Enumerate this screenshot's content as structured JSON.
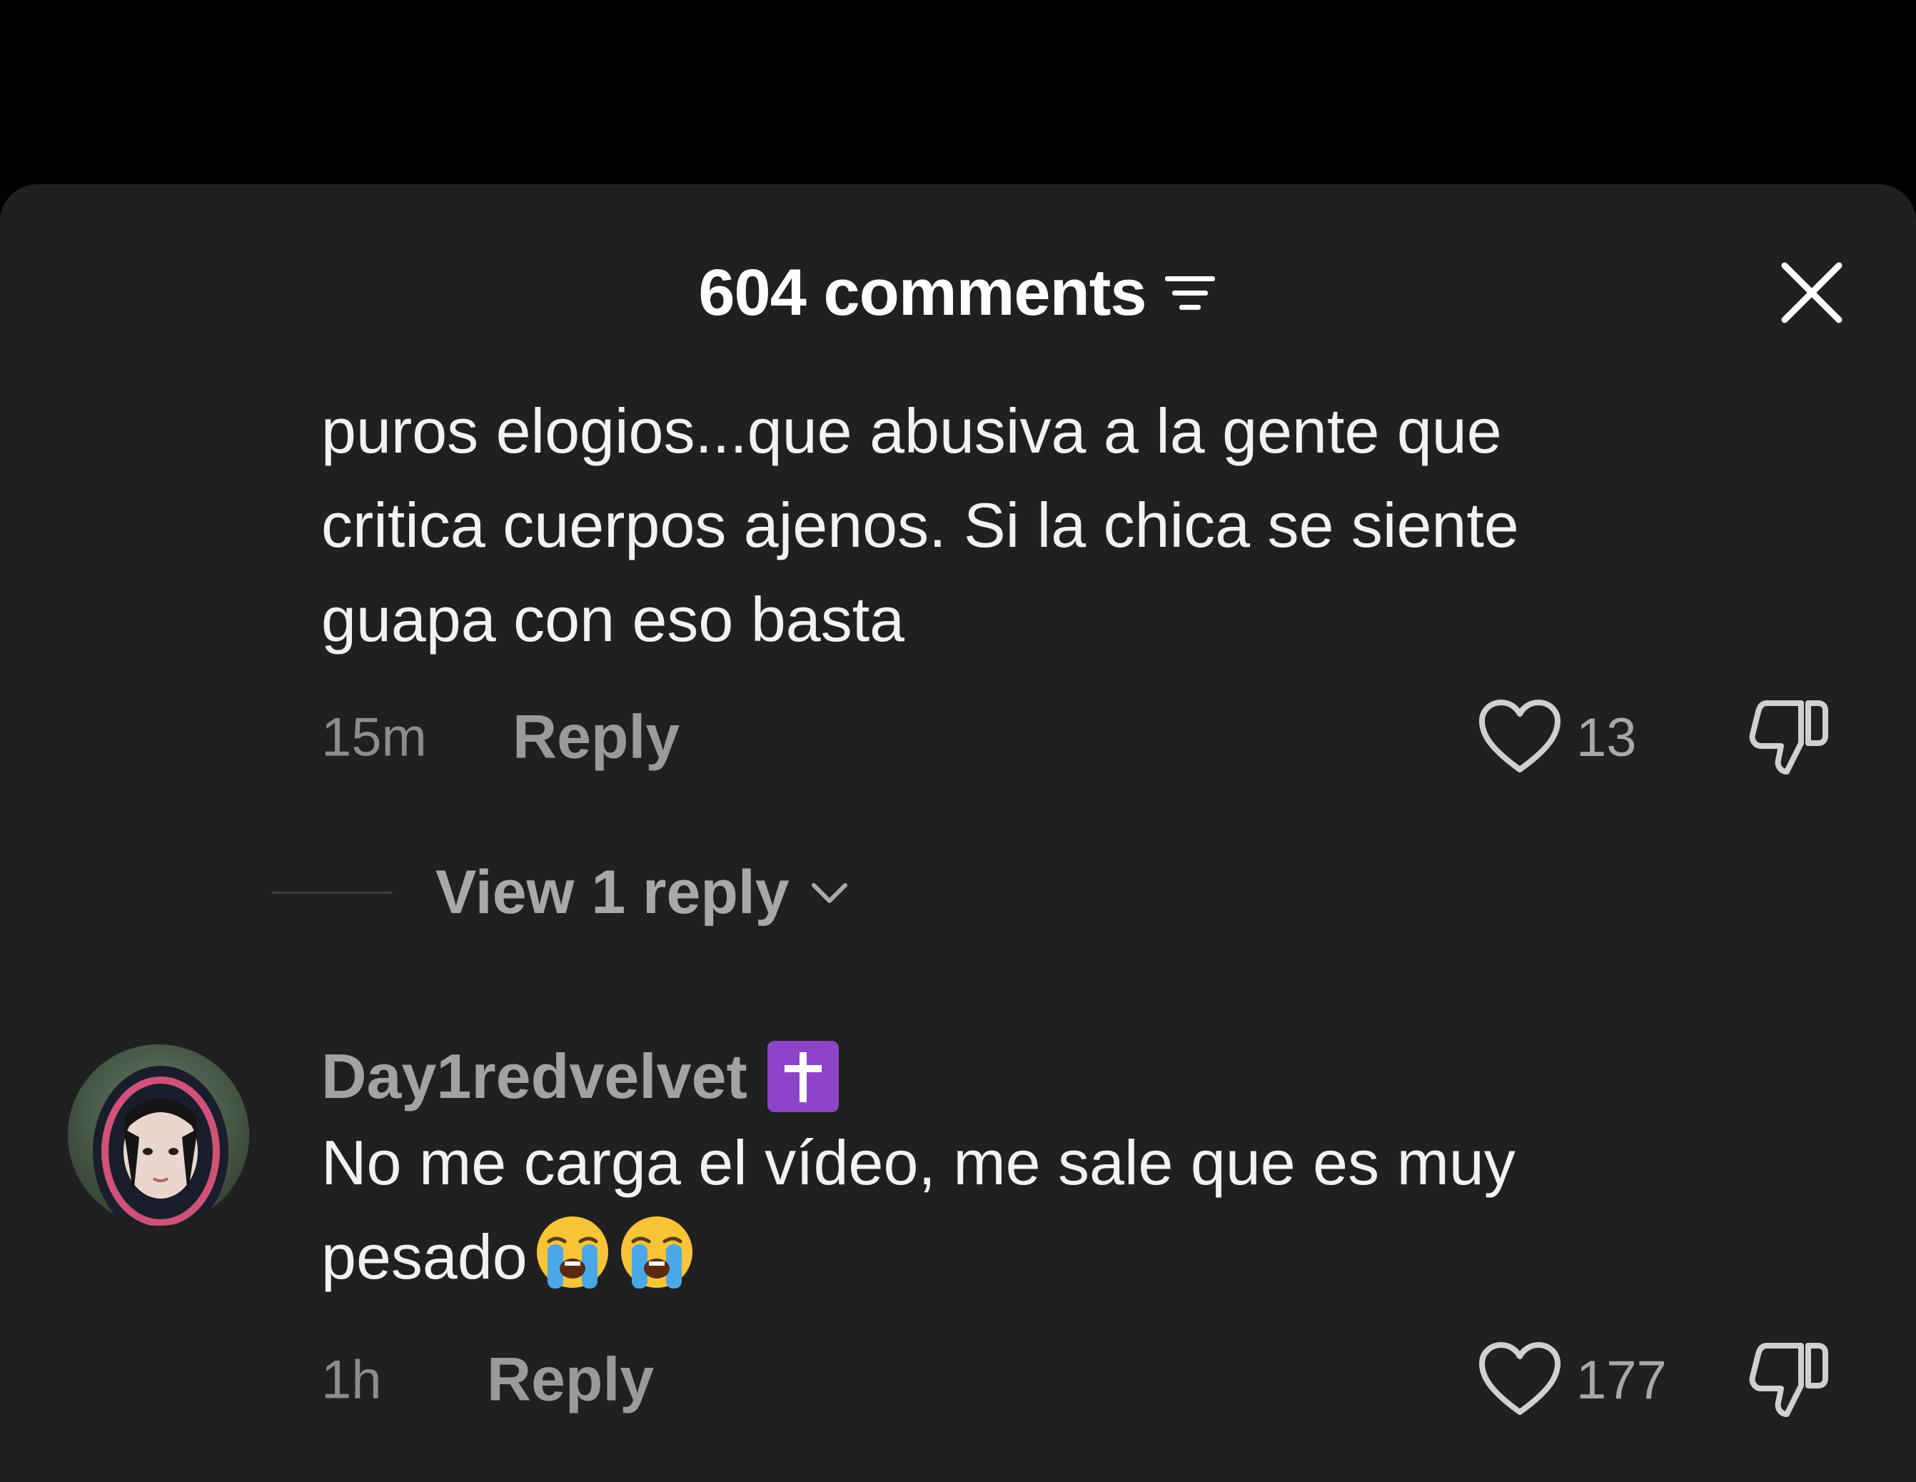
{
  "header": {
    "title": "604 comments"
  },
  "comments": [
    {
      "text": "puros elogios...que abusiva a la gente que\ncritica cuerpos ajenos. Si la chica se siente\nguapa con eso basta",
      "time": "15m",
      "reply_label": "Reply",
      "likes": "13",
      "view_replies_label": "View 1 reply"
    },
    {
      "username": "Day1redvelvet",
      "username_badge": "✝️",
      "text": "No me carga el vídeo, me sale que es muy\npesado",
      "text_emojis": "😭😭",
      "time": "1h",
      "reply_label": "Reply",
      "likes": "177"
    }
  ],
  "colors": {
    "background": "#000000",
    "sheet": "#202020",
    "primary_text": "#f2f2f2",
    "secondary_text": "#8d8d8d",
    "badge_purple": "#8e44c9"
  }
}
